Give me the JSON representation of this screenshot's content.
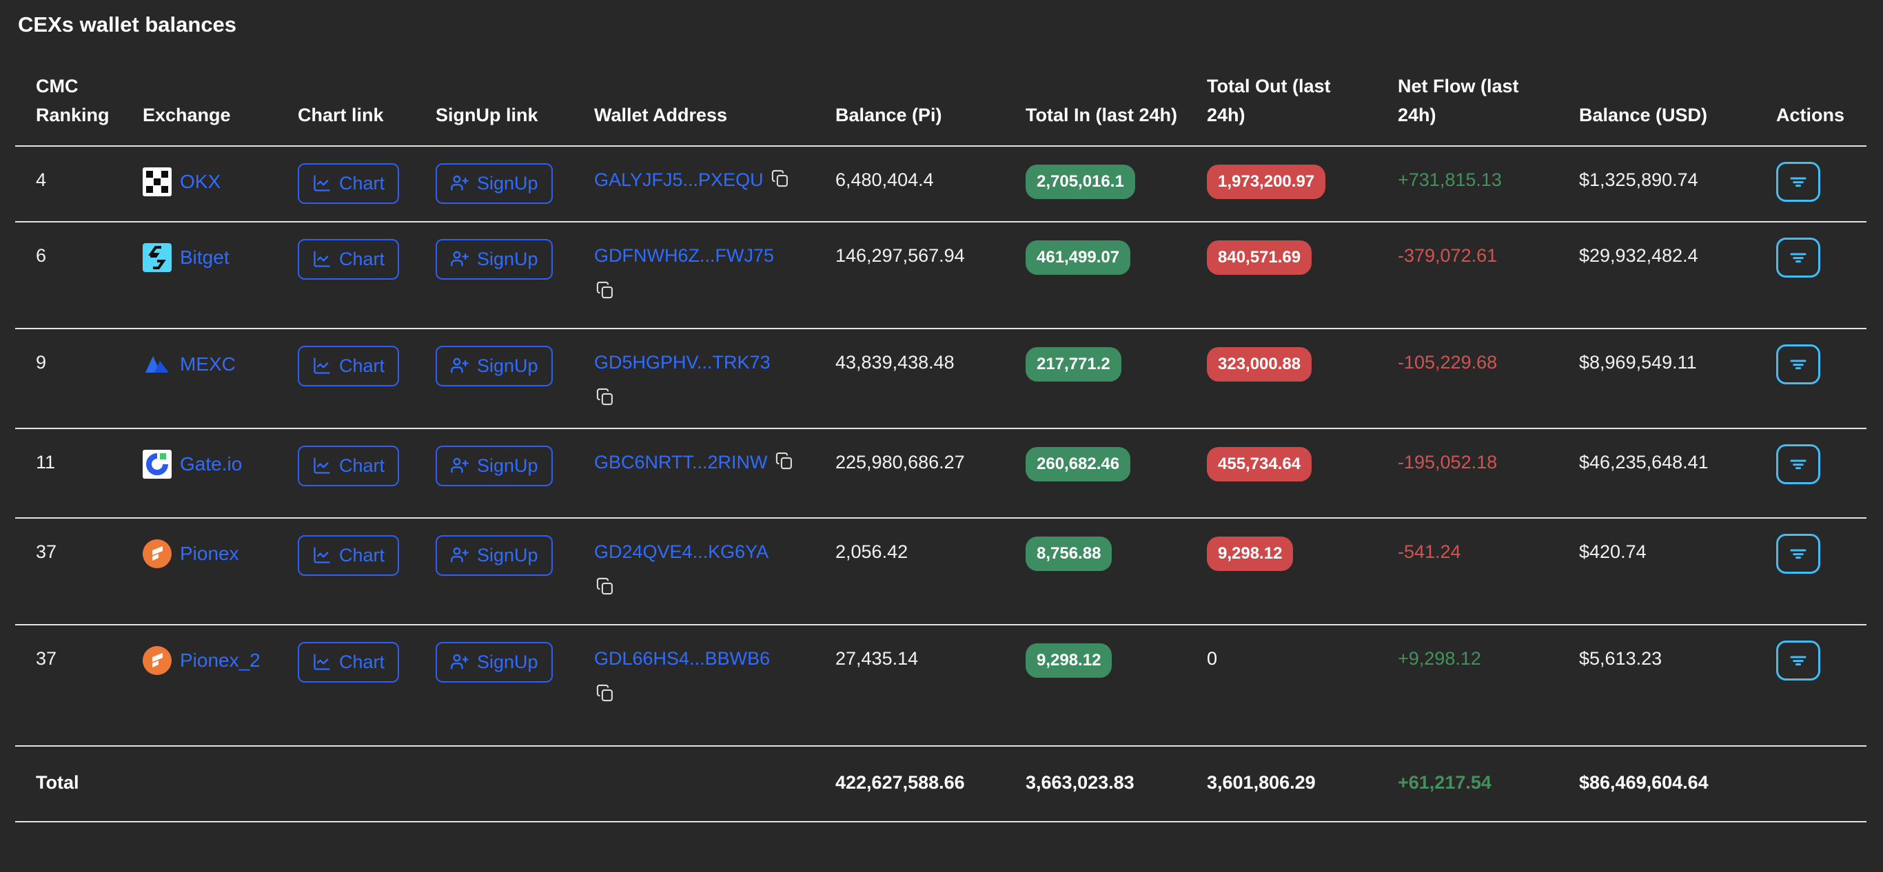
{
  "title": "CEXs wallet balances",
  "labels": {
    "chart": "Chart",
    "signup": "SignUp"
  },
  "columns": [
    {
      "label": "CMC Ranking"
    },
    {
      "label": "Exchange"
    },
    {
      "label": "Chart link"
    },
    {
      "label": "SignUp link"
    },
    {
      "label": "Wallet Address"
    },
    {
      "label": "Balance (Pi)"
    },
    {
      "label": "Total In (last 24h)"
    },
    {
      "label": "Total Out (last 24h)"
    },
    {
      "label": "Net Flow (last 24h)"
    },
    {
      "label": "Balance (USD)"
    },
    {
      "label": "Actions"
    }
  ],
  "icons": {
    "chart": "line-chart-icon",
    "signup": "user-plus-icon",
    "copy": "copy-icon",
    "actions": "filter-icon"
  },
  "colors": {
    "background": "#282828",
    "link_blue": "#2f6cff",
    "badge_green": "#3e8d62",
    "badge_red": "#ce4a4a",
    "flow_positive": "#44915d",
    "flow_negative": "#d15454",
    "actions_cyan": "#41bdf7",
    "row_divider": "#e4e4e8"
  },
  "rows": [
    {
      "ranking": "4",
      "exchange": "OKX",
      "logo": "okx-logo",
      "wallet": "GALYJFJ5...PXEQU",
      "balance_pi": "6,480,404.4",
      "total_in": "2,705,016.1",
      "total_out": "1,973,200.97",
      "net_flow": "+731,815.13",
      "balance_usd": "$1,325,890.74"
    },
    {
      "ranking": "6",
      "exchange": "Bitget",
      "logo": "bitget-logo",
      "wallet": "GDFNWH6Z...FWJ75",
      "balance_pi": "146,297,567.94",
      "total_in": "461,499.07",
      "total_out": "840,571.69",
      "net_flow": "-379,072.61",
      "balance_usd": "$29,932,482.4"
    },
    {
      "ranking": "9",
      "exchange": "MEXC",
      "logo": "mexc-logo",
      "wallet": "GD5HGPHV...TRK73",
      "balance_pi": "43,839,438.48",
      "total_in": "217,771.2",
      "total_out": "323,000.88",
      "net_flow": "-105,229.68",
      "balance_usd": "$8,969,549.11"
    },
    {
      "ranking": "11",
      "exchange": "Gate.io",
      "logo": "gate-logo",
      "wallet": "GBC6NRTT...2RINW",
      "balance_pi": "225,980,686.27",
      "total_in": "260,682.46",
      "total_out": "455,734.64",
      "net_flow": "-195,052.18",
      "balance_usd": "$46,235,648.41"
    },
    {
      "ranking": "37",
      "exchange": "Pionex",
      "logo": "pionex-logo",
      "wallet": "GD24QVE4...KG6YA",
      "balance_pi": "2,056.42",
      "total_in": "8,756.88",
      "total_out": "9,298.12",
      "net_flow": "-541.24",
      "balance_usd": "$420.74"
    },
    {
      "ranking": "37",
      "exchange": "Pionex_2",
      "logo": "pionex-logo",
      "wallet": "GDL66HS4...BBWB6",
      "balance_pi": "27,435.14",
      "total_in": "9,298.12",
      "total_out": "0",
      "net_flow": "+9,298.12",
      "balance_usd": "$5,613.23"
    }
  ],
  "totals": {
    "label": "Total",
    "balance_pi": "422,627,588.66",
    "total_in": "3,663,023.83",
    "total_out": "3,601,806.29",
    "net_flow": "+61,217.54",
    "balance_usd": "$86,469,604.64"
  }
}
